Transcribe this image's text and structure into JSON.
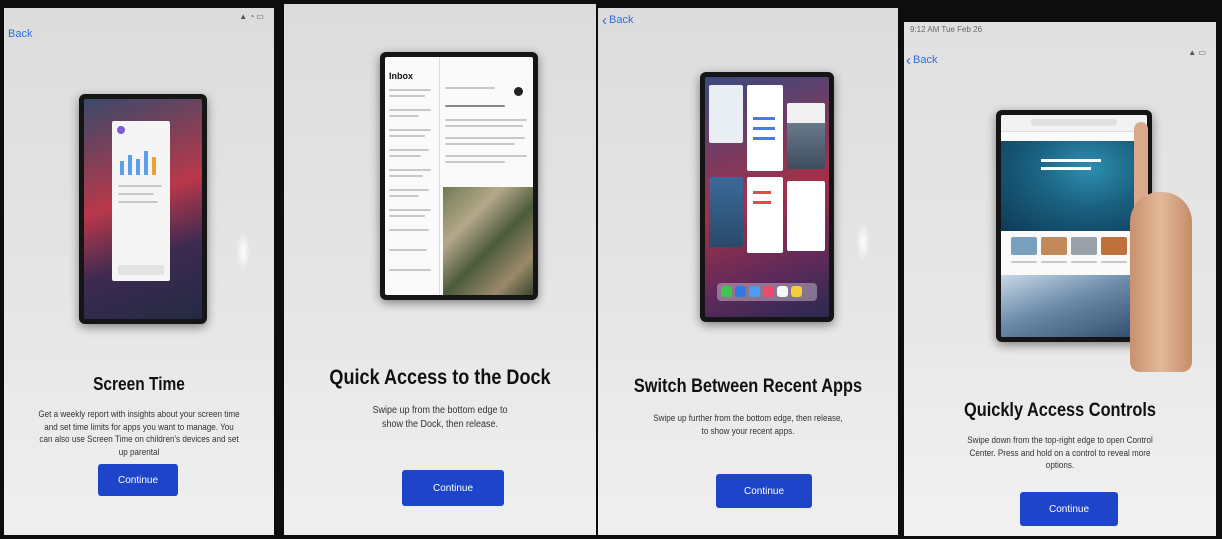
{
  "panels": [
    {
      "status_left": "",
      "status_right": "",
      "back": "Back",
      "title": "Screen Time",
      "description": "Get a weekly report with insights about your screen time and set time limits for apps you want to manage. You can also use Screen Time on children's devices and set up parental",
      "button": "Continue"
    },
    {
      "status_left": "",
      "status_right": "",
      "back": "",
      "title": "Quick Access to the Dock",
      "description": "Swipe up from the bottom edge to show the Dock, then release.",
      "button": "Continue",
      "mail": {
        "header": "Inbox"
      }
    },
    {
      "status_left": "",
      "status_right": "",
      "back": "Back",
      "title": "Switch Between Recent Apps",
      "description": "Swipe up further from the bottom edge, then release, to show your recent apps.",
      "button": "Continue"
    },
    {
      "status_left": "9:12 AM   Tue Feb 26",
      "status_right": "",
      "back": "Back",
      "title": "Quickly Access Controls",
      "description": "Swipe down from the top-right edge to open Control Center. Press and hold on a control to reveal more options.",
      "button": "Continue"
    }
  ],
  "colors": {
    "accent": "#1e45c9",
    "link": "#2f6fd6"
  },
  "icons": [
    "chevron-left-icon",
    "wifi-icon",
    "battery-icon"
  ]
}
